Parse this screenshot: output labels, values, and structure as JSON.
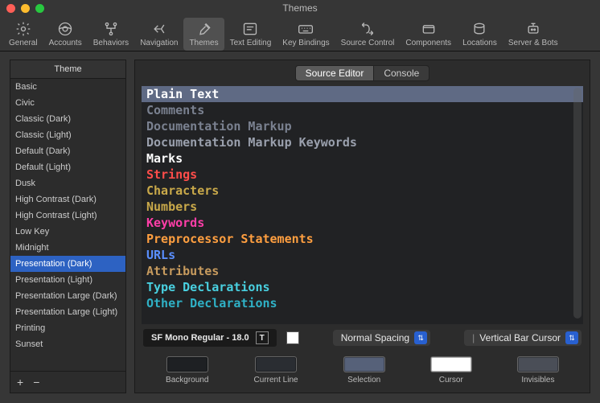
{
  "window_title": "Themes",
  "traffic": {
    "close": "#ff5f57",
    "min": "#febc2e",
    "max": "#28c840"
  },
  "toolbar": [
    {
      "name": "general",
      "label": "General"
    },
    {
      "name": "accounts",
      "label": "Accounts"
    },
    {
      "name": "behaviors",
      "label": "Behaviors"
    },
    {
      "name": "navigation",
      "label": "Navigation"
    },
    {
      "name": "themes",
      "label": "Themes",
      "active": true
    },
    {
      "name": "text-editing",
      "label": "Text Editing"
    },
    {
      "name": "key-bindings",
      "label": "Key Bindings"
    },
    {
      "name": "source-control",
      "label": "Source Control"
    },
    {
      "name": "components",
      "label": "Components"
    },
    {
      "name": "locations",
      "label": "Locations"
    },
    {
      "name": "server-bots",
      "label": "Server & Bots"
    }
  ],
  "sidebar": {
    "header": "Theme",
    "items": [
      "Basic",
      "Civic",
      "Classic (Dark)",
      "Classic (Light)",
      "Default (Dark)",
      "Default (Light)",
      "Dusk",
      "High Contrast (Dark)",
      "High Contrast (Light)",
      "Low Key",
      "Midnight",
      "Presentation (Dark)",
      "Presentation (Light)",
      "Presentation Large (Dark)",
      "Presentation Large (Light)",
      "Printing",
      "Sunset"
    ],
    "selected_index": 11,
    "add": "+",
    "remove": "−"
  },
  "tabs": {
    "source_editor": "Source Editor",
    "console": "Console",
    "active": 0
  },
  "editor_items": [
    {
      "label": "Plain Text",
      "color": "#ffffff",
      "selected": true
    },
    {
      "label": "Comments",
      "color": "#7a8190"
    },
    {
      "label": "Documentation Markup",
      "color": "#7a8190"
    },
    {
      "label": "Documentation Markup Keywords",
      "color": "#9aa0ad"
    },
    {
      "label": "Marks",
      "color": "#ffffff"
    },
    {
      "label": "Strings",
      "color": "#ff4d4a"
    },
    {
      "label": "Characters",
      "color": "#c9a94a"
    },
    {
      "label": "Numbers",
      "color": "#c9a94a"
    },
    {
      "label": "Keywords",
      "color": "#ff3ea8"
    },
    {
      "label": "Preprocessor Statements",
      "color": "#ff9f40"
    },
    {
      "label": "URLs",
      "color": "#5a8fff"
    },
    {
      "label": "Attributes",
      "color": "#c79b5e"
    },
    {
      "label": "Type Declarations",
      "color": "#49d0e0"
    },
    {
      "label": "Other Declarations",
      "color": "#2fb1c6"
    }
  ],
  "font_display": "SF Mono Regular - 18.0",
  "font_glyph": "T",
  "text_color_swatch": "#ffffff",
  "spacing_dropdown": "Normal Spacing",
  "cursor_dropdown": "Vertical Bar Cursor",
  "cursor_divider": "|",
  "swatches": [
    {
      "name": "background",
      "label": "Background",
      "color": "#1e2023"
    },
    {
      "name": "current-line",
      "label": "Current Line",
      "color": "#2a2d32"
    },
    {
      "name": "selection",
      "label": "Selection",
      "color": "#566179"
    },
    {
      "name": "cursor",
      "label": "Cursor",
      "color": "#ffffff"
    },
    {
      "name": "invisibles",
      "label": "Invisibles",
      "color": "#4a4e57"
    }
  ]
}
